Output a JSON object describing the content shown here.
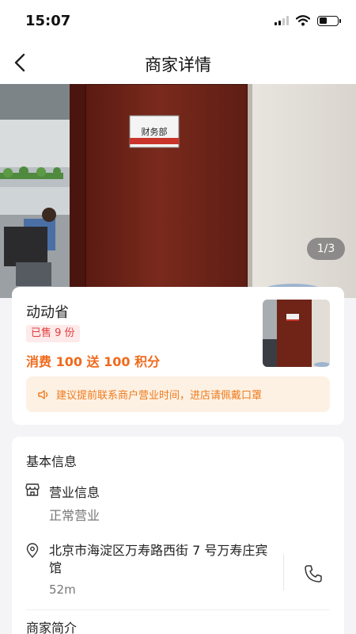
{
  "status_bar": {
    "time": "15:07"
  },
  "nav": {
    "title": "商家详情"
  },
  "gallery": {
    "counter": "1/3",
    "door_sign": "财务部"
  },
  "merchant": {
    "name": "动动省",
    "sold_badge": "已售 9 份",
    "promo": "消费 100 送 100 积分",
    "notice": "建议提前联系商户营业时间，进店请佩戴口罩"
  },
  "basic_info": {
    "title": "基本信息",
    "business_label": "营业信息",
    "business_status": "正常营业",
    "address": "北京市海淀区万寿路西街 7 号万寿庄宾馆",
    "distance": "52m"
  },
  "intro": {
    "title": "商家简介"
  },
  "colors": {
    "accent_orange": "#ef6a1c",
    "badge_red": "#e63b3b",
    "notice_bg": "#fdf1e4"
  }
}
